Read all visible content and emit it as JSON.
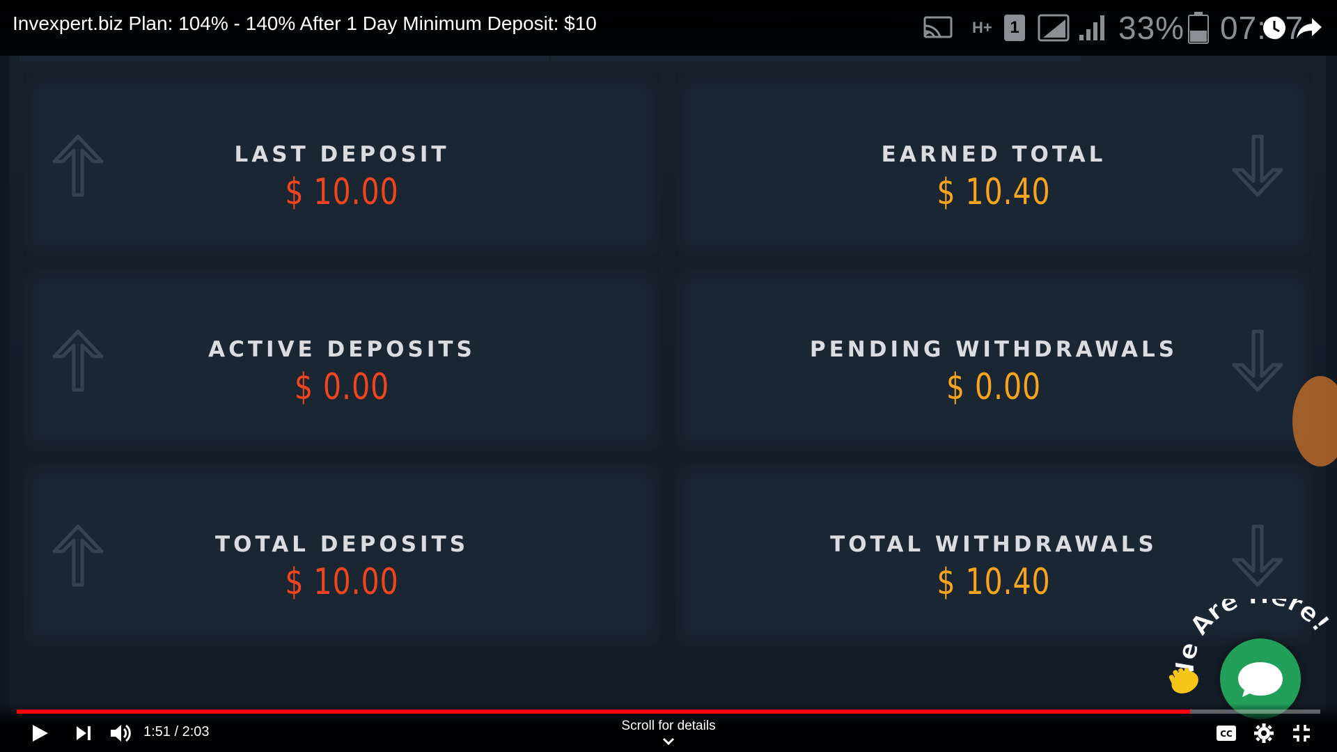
{
  "video": {
    "title": "Invexpert.biz Plan: 104% - 140% After 1 Day Minimum Deposit: $10"
  },
  "phone_status": {
    "network": "H+",
    "sim": "1",
    "battery_percent": "33%",
    "clock": "07:07"
  },
  "dashboard": {
    "cards": [
      {
        "label": "LAST DEPOSIT",
        "value": "$ 10.00",
        "arrow": "up-arrow-icon",
        "color": "#f0451f"
      },
      {
        "label": "EARNED TOTAL",
        "value": "$ 10.40",
        "arrow": "down-arrow-icon",
        "color": "#f7a51f"
      },
      {
        "label": "ACTIVE DEPOSITS",
        "value": "$ 0.00",
        "arrow": "up-arrow-icon",
        "color": "#f0451f"
      },
      {
        "label": "PENDING WITHDRAWALS",
        "value": "$ 0.00",
        "arrow": "down-arrow-icon",
        "color": "#f7a51f"
      },
      {
        "label": "TOTAL DEPOSITS",
        "value": "$ 10.00",
        "arrow": "up-arrow-icon",
        "color": "#f0451f"
      },
      {
        "label": "TOTAL WITHDRAWALS",
        "value": "$ 10.40",
        "arrow": "down-arrow-icon",
        "color": "#f7a51f"
      }
    ]
  },
  "chat_widget": {
    "badge_text": "We Are Here!",
    "icons": [
      "waving-hand-icon",
      "chat-bubble-icon"
    ]
  },
  "player": {
    "current_time": "1:51",
    "separator": "/",
    "duration": "2:03",
    "progress_fraction": 0.9,
    "scroll_hint": "Scroll for details",
    "accent_color": "#ff0000"
  }
}
